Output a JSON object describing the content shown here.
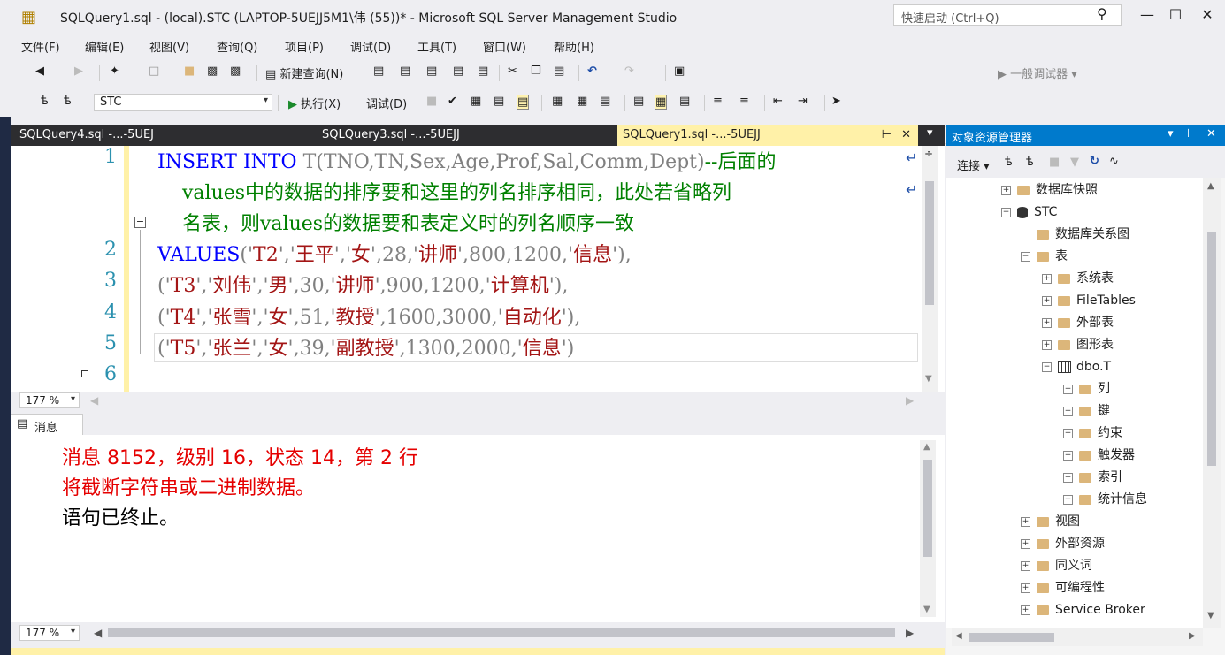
{
  "window": {
    "title": "SQLQuery1.sql - (local).STC (LAPTOP-5UEJJ5M1\\伟 (55))* - Microsoft SQL Server Management Studio",
    "quick_launch_placeholder": "快速启动 (Ctrl+Q)"
  },
  "menu": [
    "文件(F)",
    "编辑(E)",
    "视图(V)",
    "查询(Q)",
    "项目(P)",
    "调试(D)",
    "工具(T)",
    "窗口(W)",
    "帮助(H)"
  ],
  "toolbar1": {
    "new_query": "新建查询(N)",
    "debugger": "一般调试器"
  },
  "toolbar2": {
    "database": "STC",
    "execute": "执行(X)",
    "debug": "调试(D)"
  },
  "tabs": [
    {
      "label": "SQLQuery4.sql -...-5UEJ"
    },
    {
      "label": "SQLQuery3.sql -...-5UEJJ"
    },
    {
      "label": "SQLQuery1.sql -...-5UEJJ"
    }
  ],
  "editor": {
    "line_numbers": [
      "1",
      "2",
      "3",
      "4",
      "5",
      "6"
    ],
    "line1_kw1": "INSERT",
    "line1_kw2": "INTO",
    "line1_rest": "T(TNO,TN,Sex,Age,Prof,Sal,Comm,Dept)",
    "line1_comment": "--后面的",
    "line1_comment_wrap1": "values中的数据的排序要和这里的列名排序相同，此处若省略列",
    "line1_comment_wrap2": "名表，则values的数据要和表定义时的列名顺序一致",
    "line2": {
      "kw": "VALUES",
      "a": "('",
      "s1": "T2",
      "b": "','",
      "s2": "王平",
      "c": "','",
      "s3": "女",
      "d": "',28,'",
      "s4": "讲师",
      "e": "',800,1200,'",
      "s5": "信息",
      "f": "'),"
    },
    "line3": {
      "a": "('",
      "s1": "T3",
      "b": "','",
      "s2": "刘伟",
      "c": "','",
      "s3": "男",
      "d": "',30,'",
      "s4": "讲师",
      "e": "',900,1200,'",
      "s5": "计算机",
      "f": "'),"
    },
    "line4": {
      "a": "('",
      "s1": "T4",
      "b": "','",
      "s2": "张雪",
      "c": "','",
      "s3": "女",
      "d": "',51,'",
      "s4": "教授",
      "e": "',1600,3000,'",
      "s5": "自动化",
      "f": "'),"
    },
    "line5": {
      "a": "('",
      "s1": "T5",
      "b": "','",
      "s2": "张兰",
      "c": "','",
      "s3": "女",
      "d": "',39,'",
      "s4": "副教授",
      "e": "',1300,2000,'",
      "s5": "信息",
      "f": "')"
    },
    "zoom": "177 %"
  },
  "messages": {
    "tab_label": "消息",
    "line1": "消息 8152，级别 16，状态 14，第 2 行",
    "line2": "将截断字符串或二进制数据。",
    "line3": "语句已终止。",
    "zoom": "177 %"
  },
  "object_explorer": {
    "title": "对象资源管理器",
    "connect": "连接",
    "nodes": [
      {
        "label": "数据库快照"
      },
      {
        "label": "STC"
      },
      {
        "label": "数据库关系图"
      },
      {
        "label": "表"
      },
      {
        "label": "系统表"
      },
      {
        "label": "FileTables"
      },
      {
        "label": "外部表"
      },
      {
        "label": "图形表"
      },
      {
        "label": "dbo.T"
      },
      {
        "label": "列"
      },
      {
        "label": "键"
      },
      {
        "label": "约束"
      },
      {
        "label": "触发器"
      },
      {
        "label": "索引"
      },
      {
        "label": "统计信息"
      },
      {
        "label": "视图"
      },
      {
        "label": "外部资源"
      },
      {
        "label": "同义词"
      },
      {
        "label": "可编程性"
      },
      {
        "label": "Service Broker"
      }
    ]
  },
  "colors": {
    "accent": "#007acc",
    "tab_active": "#fff1a8",
    "error": "#e50000"
  }
}
